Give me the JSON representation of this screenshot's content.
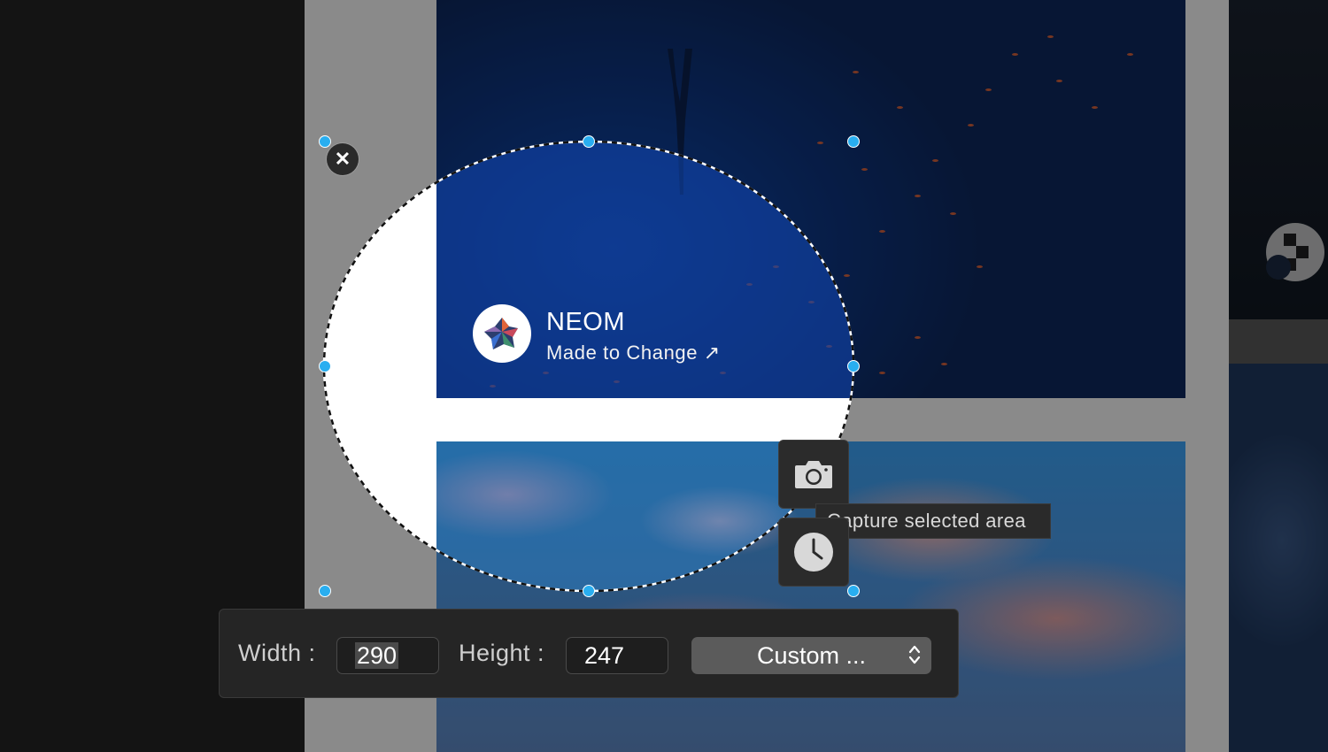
{
  "overlay": {
    "close_glyph": "✕"
  },
  "brand": {
    "name": "NEOM",
    "tagline": "Made to Change ↗"
  },
  "capture": {
    "tooltip": "Capture selected area",
    "capture_icon": "camera-icon",
    "timer_icon": "clock-icon"
  },
  "toolbar": {
    "width_label": "Width :",
    "width_value": "290",
    "height_label": "Height :",
    "height_value": "247",
    "preset_value": "Custom ..."
  },
  "colors": {
    "handle": "#29aef0",
    "toolbar_bg": "#252525",
    "preset_bg": "#5b5b5b"
  }
}
